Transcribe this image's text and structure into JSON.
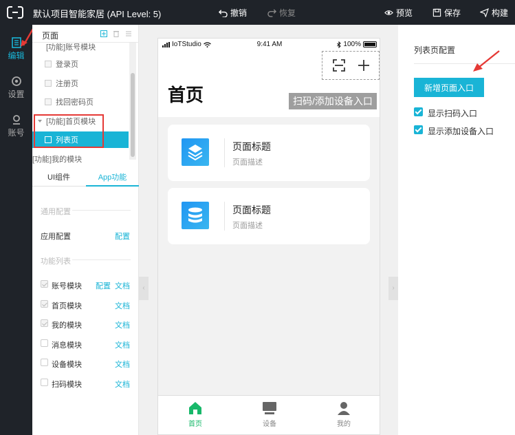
{
  "topbar": {
    "title": "默认项目智能家居 (API Level: 5)",
    "undo": "撤销",
    "redo": "恢复",
    "preview": "预览",
    "save": "保存",
    "build": "构建"
  },
  "rail": [
    {
      "label": "编辑",
      "icon": "edit-icon",
      "active": true
    },
    {
      "label": "设置",
      "icon": "settings-icon",
      "active": false
    },
    {
      "label": "账号",
      "icon": "account-icon",
      "active": false
    }
  ],
  "panel": {
    "title": "页面",
    "tree": [
      {
        "label": "[功能]账号模块",
        "type": "group-cut"
      },
      {
        "label": "登录页",
        "type": "page"
      },
      {
        "label": "注册页",
        "type": "page"
      },
      {
        "label": "找回密码页",
        "type": "page"
      },
      {
        "label": "[功能]首页模块",
        "type": "group-open"
      },
      {
        "label": "列表页",
        "type": "page-selected"
      },
      {
        "label": "[功能]我的模块",
        "type": "group-closed"
      }
    ],
    "tabs": [
      "UI组件",
      "App功能"
    ],
    "general_label": "通用配置",
    "app_config": {
      "name": "应用配置",
      "link": "配置"
    },
    "function_label": "功能列表",
    "functions": [
      {
        "name": "账号模块",
        "checked": true,
        "links": [
          "配置",
          "文档"
        ]
      },
      {
        "name": "首页模块",
        "checked": true,
        "links": [
          "文档"
        ]
      },
      {
        "name": "我的模块",
        "checked": true,
        "links": [
          "文档"
        ]
      },
      {
        "name": "消息模块",
        "checked": false,
        "links": [
          "文档"
        ]
      },
      {
        "name": "设备模块",
        "checked": false,
        "links": [
          "文档"
        ]
      },
      {
        "name": "扫码模块",
        "checked": false,
        "links": [
          "文档"
        ]
      }
    ]
  },
  "phone": {
    "carrier": "IoTStudio",
    "time": "9:41 AM",
    "battery": "100%",
    "page_title": "首页",
    "entry_tag": "扫码/添加设备入口",
    "cards": [
      {
        "title": "页面标题",
        "desc": "页面描述",
        "icon": "layers-icon"
      },
      {
        "title": "页面标题",
        "desc": "页面描述",
        "icon": "stack-icon"
      }
    ],
    "tabbar": [
      {
        "label": "首页",
        "icon": "home-icon",
        "active": true
      },
      {
        "label": "设备",
        "icon": "device-icon",
        "active": false
      },
      {
        "label": "我的",
        "icon": "user-icon",
        "active": false
      }
    ]
  },
  "right": {
    "title": "列表页配置",
    "add_button": "新增页面入口",
    "options": [
      "显示扫码入口",
      "显示添加设备入口"
    ]
  },
  "colors": {
    "accent": "#19b4d6",
    "tab_active": "#18b86a",
    "annotation": "#e53935"
  }
}
